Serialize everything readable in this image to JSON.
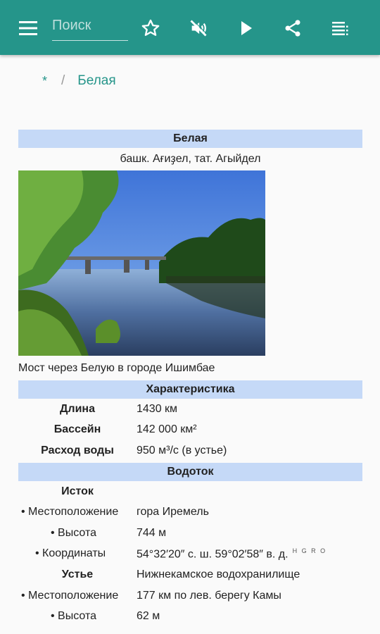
{
  "toolbar": {
    "search_placeholder": "Поиск",
    "icons": [
      "menu-icon",
      "star-icon",
      "mute-icon",
      "play-icon",
      "share-icon",
      "list-icon"
    ],
    "bg_color": "#25958a"
  },
  "breadcrumb": {
    "home": "*",
    "separator": "/",
    "current": "Белая"
  },
  "infobox": {
    "title": "Белая",
    "subtitle": "башк. Ағиҙел, тат. Агыйдел",
    "image_caption": "Мост через Белую в городе Ишимбае",
    "section_characteristics": "Характеристика",
    "characteristics": [
      {
        "label": "Длина",
        "value": "1430 км"
      },
      {
        "label": "Бассейн",
        "value": "142 000 км²"
      },
      {
        "label": "Расход воды",
        "value": "950 м³/с (в устье)"
      }
    ],
    "section_watercourse": "Водоток",
    "source_label": "Исток",
    "source_location_label": "• Местоположение",
    "source_location_value": "гора Иремель",
    "source_height_label": "• Высота",
    "source_height_value": "744 м",
    "source_coords_label": "• Координаты",
    "source_coords_value": "54°32′20″ с. ш. 59°02′58″ в. д.",
    "source_coords_links": "H G R O",
    "mouth_label": "Устье",
    "mouth_value": "Нижнекамское водохранилище",
    "mouth_location_label": "• Местоположение",
    "mouth_location_value": "177 км по лев. берегу Камы",
    "mouth_height_label": "• Высота",
    "mouth_height_value": "62 м",
    "header_color": "#c5d9f7"
  }
}
